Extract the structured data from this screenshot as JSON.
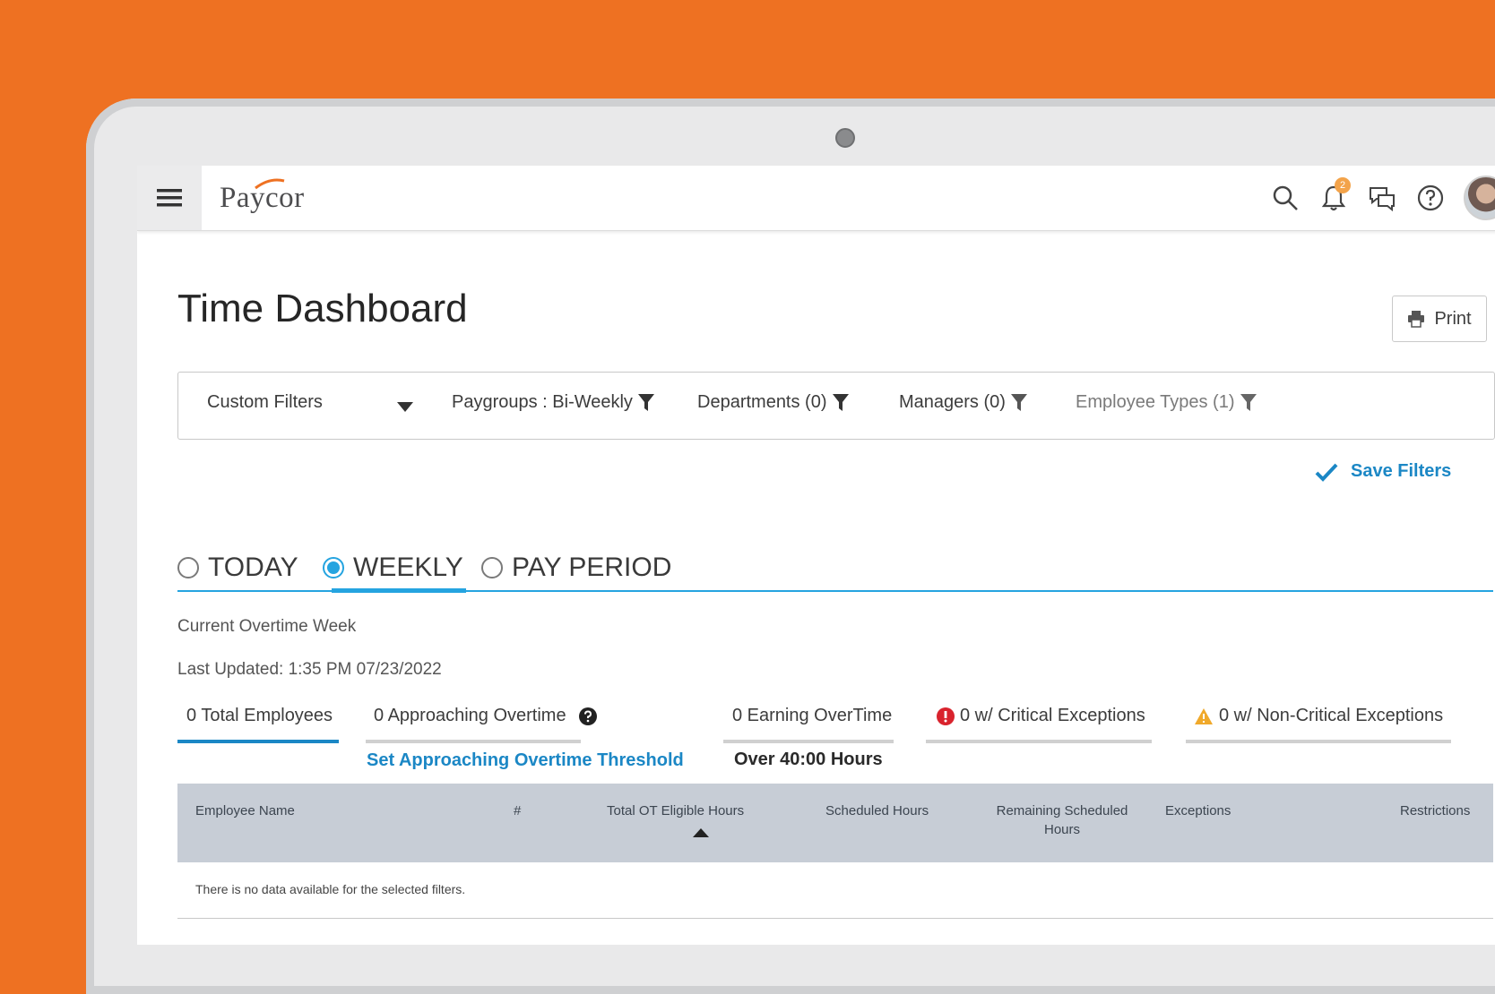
{
  "app": {
    "logo_text": "Paycor",
    "notification_count": "2",
    "icons": [
      "menu-icon",
      "search-icon",
      "bell-icon",
      "chat-icon",
      "help-icon",
      "avatar"
    ]
  },
  "page": {
    "title": "Time Dashboard",
    "print_label": "Print"
  },
  "filters": {
    "custom_filters": "Custom Filters",
    "paygroups": "Paygroups : Bi-Weekly",
    "departments": "Departments (0)",
    "managers": "Managers (0)",
    "employee_types": "Employee Types (1)",
    "save_label": "Save Filters"
  },
  "period": {
    "options": [
      "TODAY",
      "WEEKLY",
      "PAY PERIOD"
    ],
    "selected": "WEEKLY"
  },
  "meta": {
    "week_label": "Current Overtime Week",
    "last_updated": "Last Updated: 1:35 PM 07/23/2022"
  },
  "stats": {
    "total_employees": "0 Total Employees",
    "approaching_ot": "0 Approaching Overtime",
    "set_threshold": "Set Approaching Overtime Threshold",
    "earning_ot": "0 Earning OverTime",
    "over_hours": "Over 40:00 Hours",
    "critical": "0 w/ Critical Exceptions",
    "non_critical": "0 w/ Non-Critical Exceptions"
  },
  "table": {
    "columns": [
      "Employee Name",
      "#",
      "Total OT Eligible Hours",
      "Scheduled Hours",
      "Remaining Scheduled",
      "Hours",
      "Exceptions",
      "Restrictions"
    ],
    "empty_message": "There is no data available for the selected filters."
  },
  "colors": {
    "brand_orange": "#ee7122",
    "accent_blue": "#1b87c5",
    "tab_blue": "#25a4e0",
    "critical_red": "#d9232d",
    "warning_amber": "#f0a92b"
  }
}
